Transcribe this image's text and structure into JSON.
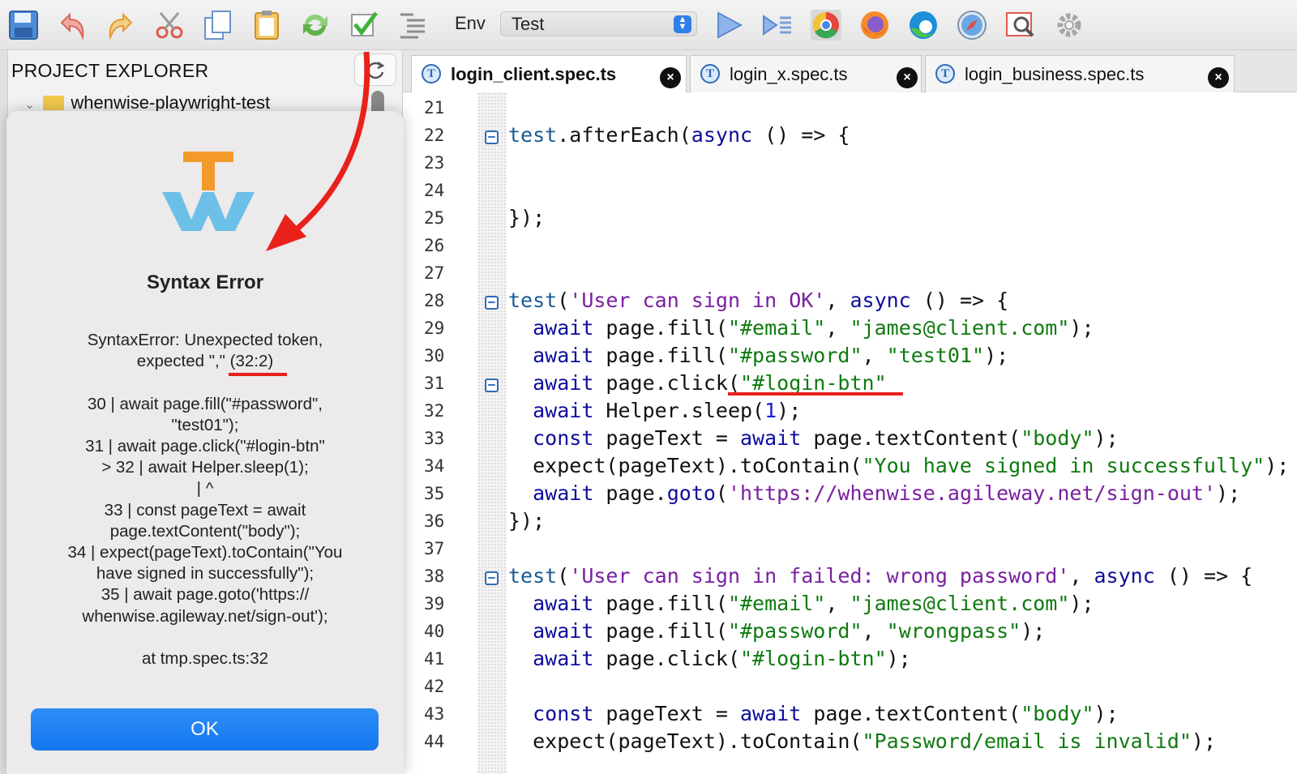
{
  "toolbar": {
    "icons": [
      "save-icon",
      "undo-icon",
      "redo-icon",
      "cut-icon",
      "copy-icon",
      "paste-icon",
      "refresh-icon",
      "check-icon",
      "list-icon"
    ],
    "env_label": "Env",
    "env_value": "Test",
    "run_icons": [
      "play-icon",
      "run-selected-icon",
      "chrome-icon",
      "firefox-icon",
      "edge-icon",
      "safari-icon",
      "inspect-icon",
      "settings-icon"
    ]
  },
  "sidebar": {
    "title": "PROJECT EXPLORER",
    "tree_item": "whenwise-playwright-test"
  },
  "dialog": {
    "title": "Syntax Error",
    "message": "SyntaxError:  Unexpected token,\nexpected \",\" (32:2)\n\n30 |   await page.fill(\"#password\",\n\"test01\");\n31 |   await page.click(\"#login-btn\"\n> 32 |   await Helper.sleep(1);\n|   ^\n33 |   const pageText = await\npage.textContent(\"body\");\n34 |   expect(pageText).toContain(\"You\nhave signed in successfully\");\n35 |   await page.goto('https://\nwhenwise.agileway.net/sign-out');\n\nat tmp.spec.ts:32",
    "ok_label": "OK"
  },
  "tabs": [
    {
      "label": "login_client.spec.ts",
      "active": true
    },
    {
      "label": "login_x.spec.ts",
      "active": false
    },
    {
      "label": "login_business.spec.ts",
      "active": false
    }
  ],
  "colors": {
    "accent": "#1476ee",
    "annotation": "#e8211b",
    "keyword": "#0d0d9a",
    "string": "#0f7a0f"
  },
  "code": [
    {
      "n": "21",
      "fold": false,
      "html": ""
    },
    {
      "n": "22",
      "fold": true,
      "html": "<span class='fn'>test</span>.afterEach(<span class='kw'>async</span> () => {"
    },
    {
      "n": "23",
      "fold": false,
      "html": ""
    },
    {
      "n": "24",
      "fold": false,
      "html": ""
    },
    {
      "n": "25",
      "fold": false,
      "html": "});"
    },
    {
      "n": "26",
      "fold": false,
      "html": ""
    },
    {
      "n": "27",
      "fold": false,
      "html": ""
    },
    {
      "n": "28",
      "fold": true,
      "html": "<span class='fn'>test</span>(<span class='str2'>'User can sign in OK'</span>, <span class='kw'>async</span> () => {"
    },
    {
      "n": "29",
      "fold": false,
      "html": "  <span class='kw'>await</span> page.fill(<span class='str'>\"#email\"</span>, <span class='str'>\"james@client.com\"</span>);"
    },
    {
      "n": "30",
      "fold": false,
      "html": "  <span class='kw'>await</span> page.fill(<span class='str'>\"#password\"</span>, <span class='str'>\"test01\"</span>);"
    },
    {
      "n": "31",
      "fold": true,
      "html": "  <span class='kw'>await</span> page.click(<span class='str'>\"#login-btn\"</span>"
    },
    {
      "n": "32",
      "fold": false,
      "html": "  <span class='kw'>await</span> Helper.sleep(<span class='num'>1</span>);"
    },
    {
      "n": "33",
      "fold": false,
      "html": "  <span class='kw'>const</span> pageText = <span class='kw'>await</span> page.textContent(<span class='str'>\"body\"</span>);"
    },
    {
      "n": "34",
      "fold": false,
      "html": "  expect(pageText).toContain(<span class='str'>\"You have signed in successfully\"</span>);"
    },
    {
      "n": "35",
      "fold": false,
      "html": "  <span class='kw'>await</span> page.<span class='kw'>goto</span>(<span class='str2'>'https://whenwise.agileway.net/sign-out'</span>);"
    },
    {
      "n": "36",
      "fold": false,
      "html": "});"
    },
    {
      "n": "37",
      "fold": false,
      "html": ""
    },
    {
      "n": "38",
      "fold": true,
      "html": "<span class='fn'>test</span>(<span class='str2'>'User can sign in failed: wrong password'</span>, <span class='kw'>async</span> () => {"
    },
    {
      "n": "39",
      "fold": false,
      "html": "  <span class='kw'>await</span> page.fill(<span class='str'>\"#email\"</span>, <span class='str'>\"james@client.com\"</span>);"
    },
    {
      "n": "40",
      "fold": false,
      "html": "  <span class='kw'>await</span> page.fill(<span class='str'>\"#password\"</span>, <span class='str'>\"wrongpass\"</span>);"
    },
    {
      "n": "41",
      "fold": false,
      "html": "  <span class='kw'>await</span> page.click(<span class='str'>\"#login-btn\"</span>);"
    },
    {
      "n": "42",
      "fold": false,
      "html": ""
    },
    {
      "n": "43",
      "fold": false,
      "html": "  <span class='kw'>const</span> pageText = <span class='kw'>await</span> page.textContent(<span class='str'>\"body\"</span>);"
    },
    {
      "n": "44",
      "fold": false,
      "html": "  expect(pageText).toContain(<span class='str'>\"Password/email is invalid\"</span>);"
    }
  ]
}
